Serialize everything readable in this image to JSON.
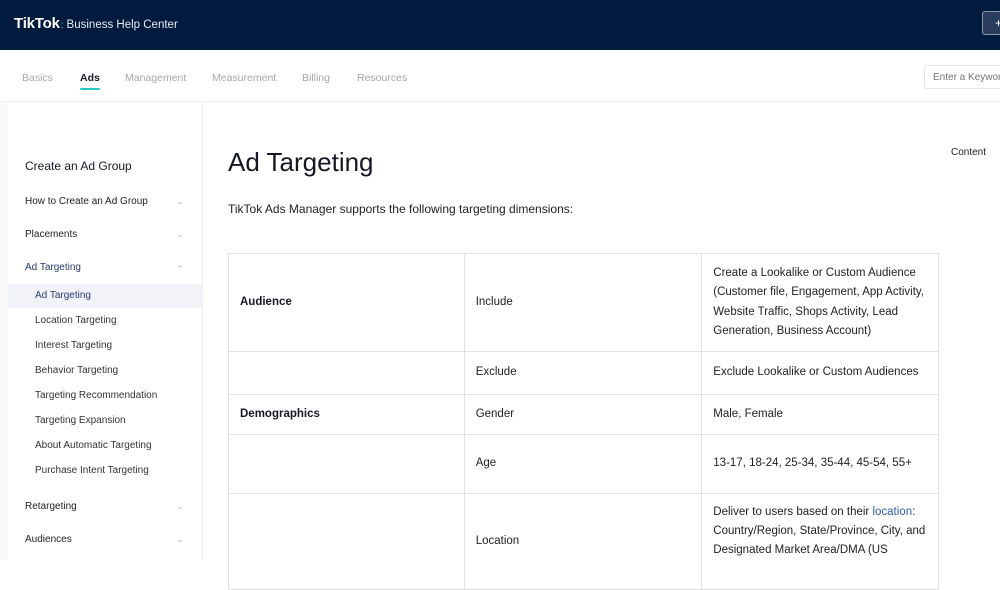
{
  "header": {
    "logo_brand": "TikTok",
    "logo_dot": ":",
    "logo_subtitle": "Business Help Center",
    "top_button_label": "+"
  },
  "nav": {
    "tabs": [
      {
        "label": "Basics",
        "active": false
      },
      {
        "label": "Ads",
        "active": true
      },
      {
        "label": "Management",
        "active": false
      },
      {
        "label": "Measurement",
        "active": false
      },
      {
        "label": "Billing",
        "active": false
      },
      {
        "label": "Resources",
        "active": false
      }
    ],
    "search_placeholder": "Enter a Keyword"
  },
  "sidebar": {
    "title": "Create an Ad Group",
    "sections": [
      {
        "label": "How to Create an Ad Group",
        "chevron": "chevron-down"
      },
      {
        "label": "Placements",
        "chevron": "chevron-down"
      },
      {
        "label": "Ad Targeting",
        "chevron": "chevron-up"
      }
    ],
    "subitems": [
      {
        "label": "Ad Targeting",
        "active": true
      },
      {
        "label": "Location Targeting"
      },
      {
        "label": "Interest Targeting"
      },
      {
        "label": "Behavior Targeting"
      },
      {
        "label": "Targeting Recommendation"
      },
      {
        "label": "Targeting Expansion"
      },
      {
        "label": "About Automatic Targeting"
      },
      {
        "label": "Purchase Intent Targeting"
      }
    ],
    "after_sections": [
      {
        "label": "Retargeting",
        "chevron": "chevron-down"
      },
      {
        "label": "Audiences",
        "chevron": "chevron-down"
      }
    ],
    "chevron_down_glyph": "⌄",
    "chevron_up_glyph": "⌃"
  },
  "main": {
    "title": "Ad Targeting",
    "intro": "TikTok Ads Manager supports the following targeting dimensions:",
    "toc_label": "Content",
    "table": {
      "rows": [
        {
          "category": "Audience",
          "option": "Include",
          "description": "Create a Lookalike or Custom Audience (Customer file, Engagement, App Activity, Website Traffic, Shops Activity, Lead Generation, Business Account)"
        },
        {
          "category": "",
          "option": "Exclude",
          "description": "Exclude Lookalike or Custom Audiences"
        },
        {
          "category": "Demographics",
          "option": "Gender",
          "description": "Male, Female"
        },
        {
          "category": "",
          "option": "Age",
          "description": "13-17, 18-24, 25-34, 35-44, 45-54, 55+"
        },
        {
          "category": "",
          "option": "Location",
          "description_prefix": "Deliver to users based on their ",
          "description_link": "location",
          "description_suffix": ": Country/Region, State/Province, City, and Designated Market Area/DMA (US"
        }
      ]
    }
  },
  "colors": {
    "header_bg": "#001b3d",
    "accent": "#25c6c4",
    "link": "#2f62b0",
    "active_sidebar": "#2b3d6e"
  }
}
